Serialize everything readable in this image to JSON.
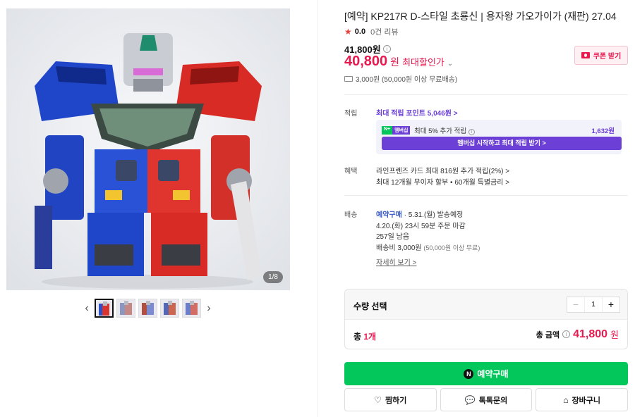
{
  "gallery": {
    "counter": "1/8",
    "thumbs_count": 5,
    "active_thumb": 0
  },
  "product": {
    "title": "[예약] KP217R D-스타일 초룡신 | 용자왕 가오가이가 (재판) 27.04",
    "rating": "0.0",
    "reviews": "0건 리뷰",
    "original_price": "41,800원",
    "sale_price": "40,800",
    "sale_unit": "원",
    "sale_label": "최대할인가",
    "coupon_label": "쿠폰 받기",
    "shipping_summary": "3,000원 (50,000원 이상 무료배송)"
  },
  "points": {
    "label": "적립",
    "max_point": "최대 적립 포인트 5,046원 >",
    "badge_n": "N+",
    "badge_membership": "멤버십",
    "extra_text": "최대 5% 추가 적립",
    "extra_amount": "1,632원",
    "cta": "멤버십 시작하고 최대 적립 받기 >"
  },
  "benefits": {
    "label": "혜택",
    "line1": "라인프렌즈 카드 최대 816원 추가 적립(2%) >",
    "line2": "최대 12개월 무이자 할부 • 60개월 특별금리 >"
  },
  "delivery": {
    "label": "배송",
    "type": "예약구매",
    "ship_date": "· 5.31.(월) 발송예정",
    "deadline": "4.20.(화) 23시 59분 주문 마감",
    "remaining": "257일 남음",
    "fee": "배송비 3,000원",
    "fee_note": "(50,000원 이상 무료)",
    "details_link": "자세히 보기 >"
  },
  "quantity": {
    "title": "수량 선택",
    "value": "1",
    "minus": "−",
    "plus": "+"
  },
  "total": {
    "count_prefix": "총 ",
    "count": "1개",
    "amount_label": "총 금액",
    "amount": "41,800",
    "unit": "원"
  },
  "actions": {
    "buy": "예약구매",
    "wish": "찜하기",
    "talk": "톡톡문의",
    "cart": "장바구니"
  },
  "colors": {
    "sale": "#e8194f",
    "naver_green": "#03c75a",
    "membership_purple": "#6c3fd6"
  }
}
